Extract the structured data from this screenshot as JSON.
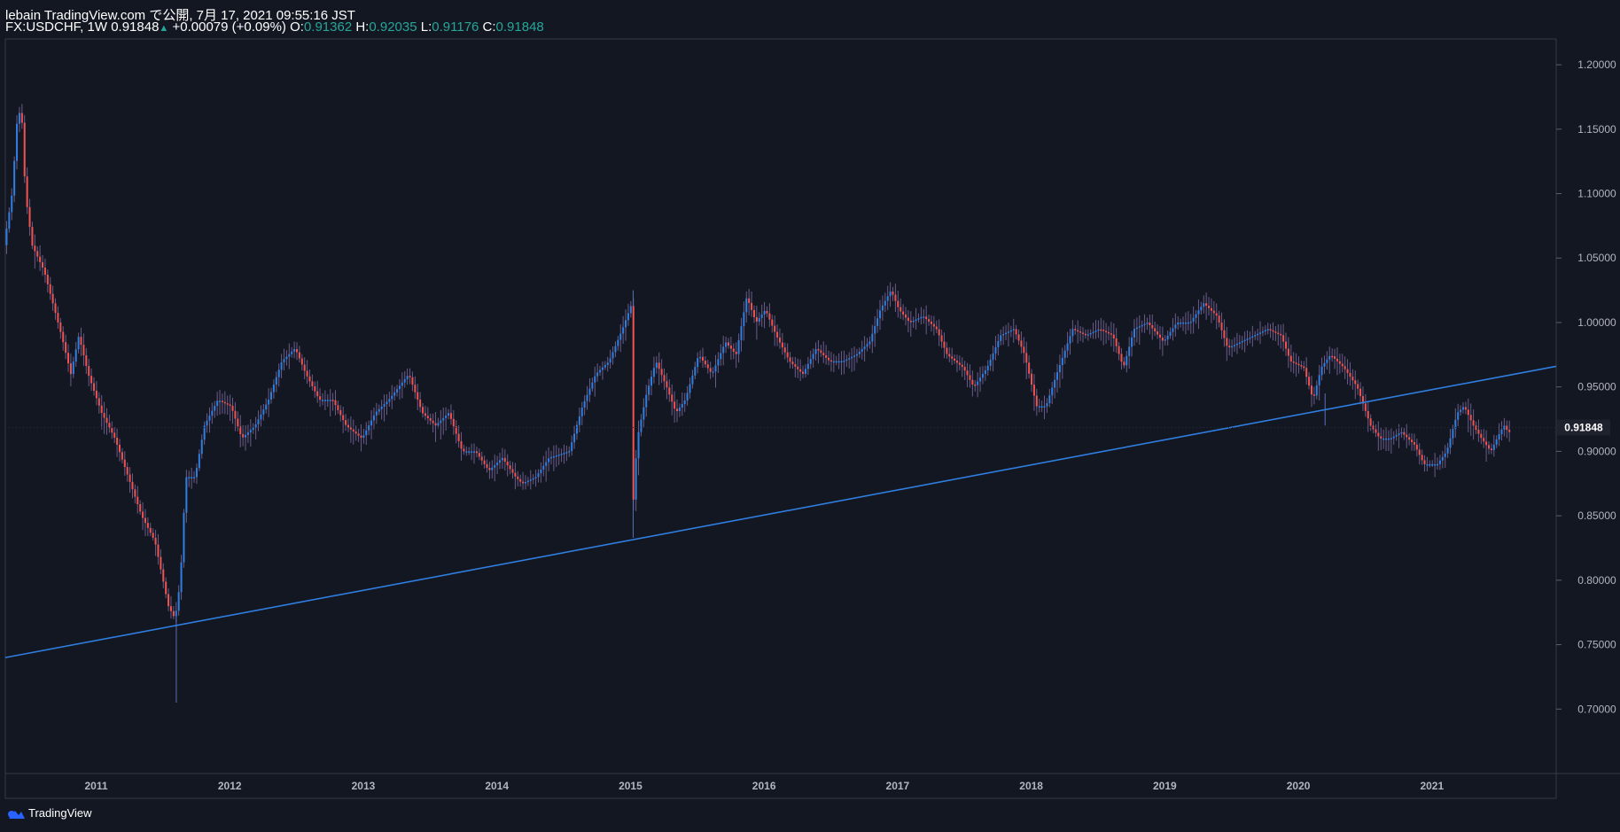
{
  "header": {
    "publish_line": "lebain TradingView.com で公開, 7月 17, 2021 09:55:16 JST",
    "symbol": "FX:USDCHF, 1W",
    "last_price": "0.91848",
    "change": "+0.00079 (+0.09%)",
    "o_label": "O:",
    "o_value": "0.91362",
    "h_label": "H:",
    "h_value": "0.92035",
    "l_label": "L:",
    "l_value": "0.91176",
    "c_label": "C:",
    "c_value": "0.91848"
  },
  "footer": {
    "brand": "TradingView"
  },
  "chart_data": {
    "type": "candlestick",
    "symbol": "FX:USDCHF",
    "interval": "1W",
    "ylim": [
      0.65,
      1.22
    ],
    "xlim": [
      2010.32,
      2021.93
    ],
    "y_ticks": [
      "0.70000",
      "0.75000",
      "0.80000",
      "0.85000",
      "0.90000",
      "0.95000",
      "1.00000",
      "1.05000",
      "1.10000",
      "1.15000",
      "1.20000"
    ],
    "x_ticks": [
      "2011",
      "2012",
      "2013",
      "2014",
      "2015",
      "2016",
      "2017",
      "2018",
      "2019",
      "2020",
      "2021"
    ],
    "last_price_label": "0.91848",
    "colors": {
      "up": "#2f7ee0",
      "down": "#ef5350",
      "trendline": "#2f7ee0",
      "background": "#131722"
    },
    "path": [
      [
        2010.32,
        1.06
      ],
      [
        2010.38,
        1.1
      ],
      [
        2010.42,
        1.16
      ],
      [
        2010.45,
        1.165
      ],
      [
        2010.48,
        1.1
      ],
      [
        2010.53,
        1.06
      ],
      [
        2010.62,
        1.04
      ],
      [
        2010.75,
        0.99
      ],
      [
        2010.82,
        0.96
      ],
      [
        2010.88,
        0.99
      ],
      [
        2010.95,
        0.96
      ],
      [
        2011.05,
        0.93
      ],
      [
        2011.15,
        0.91
      ],
      [
        2011.25,
        0.88
      ],
      [
        2011.35,
        0.85
      ],
      [
        2011.45,
        0.83
      ],
      [
        2011.55,
        0.78
      ],
      [
        2011.6,
        0.77
      ],
      [
        2011.64,
        0.8
      ],
      [
        2011.68,
        0.88
      ],
      [
        2011.75,
        0.88
      ],
      [
        2011.82,
        0.92
      ],
      [
        2011.92,
        0.94
      ],
      [
        2012.02,
        0.935
      ],
      [
        2012.1,
        0.91
      ],
      [
        2012.2,
        0.92
      ],
      [
        2012.3,
        0.94
      ],
      [
        2012.4,
        0.97
      ],
      [
        2012.5,
        0.98
      ],
      [
        2012.58,
        0.96
      ],
      [
        2012.68,
        0.94
      ],
      [
        2012.78,
        0.94
      ],
      [
        2012.88,
        0.92
      ],
      [
        2013.0,
        0.91
      ],
      [
        2013.1,
        0.93
      ],
      [
        2013.2,
        0.94
      ],
      [
        2013.35,
        0.96
      ],
      [
        2013.45,
        0.93
      ],
      [
        2013.55,
        0.92
      ],
      [
        2013.65,
        0.93
      ],
      [
        2013.75,
        0.9
      ],
      [
        2013.85,
        0.9
      ],
      [
        2013.95,
        0.885
      ],
      [
        2014.05,
        0.895
      ],
      [
        2014.15,
        0.88
      ],
      [
        2014.2,
        0.875
      ],
      [
        2014.3,
        0.88
      ],
      [
        2014.4,
        0.895
      ],
      [
        2014.55,
        0.9
      ],
      [
        2014.65,
        0.935
      ],
      [
        2014.75,
        0.96
      ],
      [
        2014.85,
        0.97
      ],
      [
        2014.95,
        0.995
      ],
      [
        2015.02,
        1.015
      ],
      [
        2015.03,
        0.86
      ],
      [
        2015.06,
        0.91
      ],
      [
        2015.13,
        0.945
      ],
      [
        2015.2,
        0.97
      ],
      [
        2015.28,
        0.95
      ],
      [
        2015.35,
        0.93
      ],
      [
        2015.42,
        0.94
      ],
      [
        2015.52,
        0.975
      ],
      [
        2015.62,
        0.96
      ],
      [
        2015.72,
        0.985
      ],
      [
        2015.8,
        0.975
      ],
      [
        2015.88,
        1.02
      ],
      [
        2015.95,
        1.0
      ],
      [
        2016.02,
        1.01
      ],
      [
        2016.1,
        0.99
      ],
      [
        2016.2,
        0.97
      ],
      [
        2016.3,
        0.96
      ],
      [
        2016.4,
        0.98
      ],
      [
        2016.5,
        0.97
      ],
      [
        2016.6,
        0.97
      ],
      [
        2016.7,
        0.975
      ],
      [
        2016.8,
        0.985
      ],
      [
        2016.88,
        1.01
      ],
      [
        2016.96,
        1.025
      ],
      [
        2017.02,
        1.01
      ],
      [
        2017.1,
        1.0
      ],
      [
        2017.2,
        1.005
      ],
      [
        2017.3,
        0.995
      ],
      [
        2017.38,
        0.975
      ],
      [
        2017.5,
        0.965
      ],
      [
        2017.58,
        0.95
      ],
      [
        2017.68,
        0.965
      ],
      [
        2017.78,
        0.99
      ],
      [
        2017.88,
        0.995
      ],
      [
        2017.96,
        0.975
      ],
      [
        2018.05,
        0.935
      ],
      [
        2018.12,
        0.935
      ],
      [
        2018.2,
        0.96
      ],
      [
        2018.32,
        0.995
      ],
      [
        2018.42,
        0.99
      ],
      [
        2018.52,
        0.995
      ],
      [
        2018.62,
        0.99
      ],
      [
        2018.7,
        0.965
      ],
      [
        2018.78,
        0.995
      ],
      [
        2018.88,
        1.0
      ],
      [
        2019.0,
        0.985
      ],
      [
        2019.1,
        1.0
      ],
      [
        2019.2,
        1.0
      ],
      [
        2019.3,
        1.015
      ],
      [
        2019.4,
        1.005
      ],
      [
        2019.48,
        0.98
      ],
      [
        2019.58,
        0.985
      ],
      [
        2019.68,
        0.99
      ],
      [
        2019.78,
        0.995
      ],
      [
        2019.88,
        0.99
      ],
      [
        2019.95,
        0.97
      ],
      [
        2020.05,
        0.965
      ],
      [
        2020.12,
        0.94
      ],
      [
        2020.18,
        0.965
      ],
      [
        2020.25,
        0.975
      ],
      [
        2020.35,
        0.965
      ],
      [
        2020.45,
        0.95
      ],
      [
        2020.55,
        0.92
      ],
      [
        2020.62,
        0.91
      ],
      [
        2020.7,
        0.91
      ],
      [
        2020.78,
        0.915
      ],
      [
        2020.88,
        0.905
      ],
      [
        2020.95,
        0.89
      ],
      [
        2021.05,
        0.89
      ],
      [
        2021.12,
        0.9
      ],
      [
        2021.2,
        0.93
      ],
      [
        2021.25,
        0.935
      ],
      [
        2021.32,
        0.92
      ],
      [
        2021.38,
        0.91
      ],
      [
        2021.45,
        0.9
      ],
      [
        2021.52,
        0.915
      ],
      [
        2021.55,
        0.92
      ],
      [
        2021.58,
        0.915
      ]
    ],
    "spikes": [
      {
        "x": 2011.6,
        "high": 0.775,
        "low": 0.705
      },
      {
        "x": 2015.02,
        "high": 1.025,
        "low": 0.833
      },
      {
        "x": 2020.2,
        "high": 0.945,
        "low": 0.92
      }
    ],
    "trendline": {
      "x1": 2010.32,
      "y1": 0.74,
      "x2": 2021.93,
      "y2": 0.966
    }
  }
}
